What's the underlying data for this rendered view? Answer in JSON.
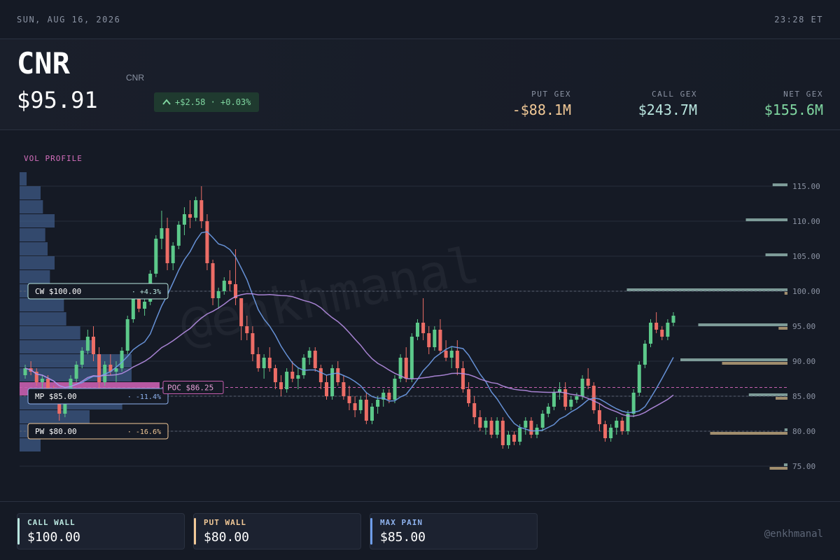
{
  "topbar": {
    "date": "SUN, AUG 16, 2026",
    "time": "23:28 ET"
  },
  "header": {
    "ticker": "CNR",
    "ticker_sub": "CNR",
    "price": "$95.91",
    "change": "+$2.58 · +0.03%"
  },
  "gex": {
    "put": {
      "label": "PUT GEX",
      "value": "-$88.1M"
    },
    "call": {
      "label": "CALL GEX",
      "value": "$243.7M"
    },
    "net": {
      "label": "NET GEX",
      "value": "$155.6M"
    }
  },
  "watermark": "@enkhmanal",
  "chart_data": {
    "type": "candlestick",
    "ylim": [
      73,
      117
    ],
    "y_ticks": [
      "115.00",
      "110.00",
      "105.00",
      "100.00",
      "95.00",
      "90.00",
      "85.00",
      "80.00",
      "75.00"
    ],
    "vol_profile_label": "VOL PROFILE",
    "levels": [
      {
        "label": "CW $100.00",
        "pct": "+4.3%",
        "price": 100,
        "color": "#b9e6df"
      },
      {
        "label": "MP $85.00",
        "pct": "-11.4%",
        "price": 85,
        "color": "#8fb3ef"
      },
      {
        "label": "PW $80.00",
        "pct": "-16.6%",
        "price": 80,
        "color": "#f2c997"
      }
    ],
    "poc": {
      "label": "POC $86.25",
      "price": 86.25
    },
    "gex_bars": {
      "call": [
        [
          115,
          0.25
        ],
        [
          110,
          0.7
        ],
        [
          105,
          0.37
        ],
        [
          100,
          2.7
        ],
        [
          95,
          1.5
        ],
        [
          90,
          1.8
        ],
        [
          85,
          0.65
        ],
        [
          80,
          0.05
        ],
        [
          75,
          0.06
        ]
      ],
      "put": [
        [
          100,
          0.05
        ],
        [
          95,
          0.15
        ],
        [
          90,
          1.1
        ],
        [
          85,
          0.2
        ],
        [
          80,
          1.3
        ],
        [
          75,
          0.3
        ]
      ]
    },
    "volume_profile": [
      [
        116,
        0.15
      ],
      [
        114,
        0.45
      ],
      [
        112,
        0.5
      ],
      [
        110,
        0.75
      ],
      [
        108,
        0.55
      ],
      [
        106,
        0.6
      ],
      [
        104,
        0.75
      ],
      [
        102,
        0.65
      ],
      [
        100,
        0.95
      ],
      [
        98,
        0.95
      ],
      [
        96,
        1.0
      ],
      [
        94,
        1.3
      ],
      [
        92,
        1.6
      ],
      [
        90,
        2.4
      ],
      [
        88,
        2.4
      ],
      [
        86,
        3.0
      ],
      [
        84,
        2.2
      ],
      [
        82,
        1.5
      ],
      [
        80,
        0.7
      ],
      [
        78,
        0.45
      ]
    ],
    "candles": [
      [
        88,
        89.5,
        87.5,
        89
      ],
      [
        89,
        90,
        88,
        88.5
      ],
      [
        88.5,
        89,
        86.5,
        87
      ],
      [
        87,
        88,
        86,
        87.5
      ],
      [
        87.5,
        88,
        85.5,
        86
      ],
      [
        86,
        86.5,
        84,
        85
      ],
      [
        85,
        85.5,
        81.5,
        82.5
      ],
      [
        82.5,
        85,
        82,
        84.5
      ],
      [
        84.5,
        88,
        84,
        87.5
      ],
      [
        87.5,
        90,
        87,
        89.5
      ],
      [
        89.5,
        92,
        89,
        91.5
      ],
      [
        91.5,
        94.5,
        91,
        93.5
      ],
      [
        93.5,
        95,
        90,
        91
      ],
      [
        91,
        92,
        86,
        87
      ],
      [
        87,
        90,
        86.5,
        89.5
      ],
      [
        89.5,
        91,
        88,
        88.5
      ],
      [
        88.5,
        90,
        87,
        89
      ],
      [
        89,
        92,
        88.5,
        91.5
      ],
      [
        91.5,
        96.5,
        91,
        96
      ],
      [
        96,
        99.5,
        95.5,
        99
      ],
      [
        99,
        100,
        97,
        97.5
      ],
      [
        97.5,
        99,
        96.5,
        98.5
      ],
      [
        98.5,
        103,
        98,
        102.5
      ],
      [
        102.5,
        108,
        102,
        107.5
      ],
      [
        107.5,
        111.5,
        106,
        109
      ],
      [
        109,
        110.5,
        103,
        104
      ],
      [
        104,
        107,
        103,
        106.5
      ],
      [
        106.5,
        110,
        106,
        109.5
      ],
      [
        109.5,
        112,
        108,
        111
      ],
      [
        111,
        113,
        109,
        110.5
      ],
      [
        110.5,
        113.5,
        110,
        113
      ],
      [
        113,
        115,
        109,
        110
      ],
      [
        110,
        111,
        103,
        104
      ],
      [
        104,
        104.5,
        98,
        99
      ],
      [
        99,
        100.5,
        97.5,
        100
      ],
      [
        100,
        102,
        99.5,
        101.5
      ],
      [
        101.5,
        103,
        100,
        101
      ],
      [
        101,
        106,
        98,
        99
      ],
      [
        99,
        97,
        93,
        95
      ],
      [
        95,
        96.5,
        93,
        94
      ],
      [
        94,
        95,
        90,
        91
      ],
      [
        91,
        92,
        88.5,
        89
      ],
      [
        89,
        91,
        87.5,
        90.5
      ],
      [
        90.5,
        92,
        88.5,
        89
      ],
      [
        89,
        89.5,
        86,
        87
      ],
      [
        87,
        88,
        85,
        86
      ],
      [
        86,
        89,
        85.5,
        88.5
      ],
      [
        88.5,
        90,
        87,
        87.5
      ],
      [
        87.5,
        89,
        86,
        88
      ],
      [
        88,
        91,
        87.5,
        90.5
      ],
      [
        90.5,
        92,
        89.5,
        91.5
      ],
      [
        91.5,
        92,
        88.5,
        89
      ],
      [
        89,
        89.5,
        86,
        87
      ],
      [
        87,
        88,
        84.5,
        85
      ],
      [
        85,
        89.5,
        84.5,
        89
      ],
      [
        89,
        90,
        86.5,
        87
      ],
      [
        87,
        88,
        84.5,
        85
      ],
      [
        85,
        86.5,
        83,
        84
      ],
      [
        84,
        85,
        82,
        83
      ],
      [
        83,
        85,
        82.5,
        84.5
      ],
      [
        84.5,
        85.5,
        81,
        81.5
      ],
      [
        81.5,
        84,
        81,
        83.5
      ],
      [
        83.5,
        85,
        82.5,
        84.5
      ],
      [
        84.5,
        86,
        83.5,
        85.5
      ],
      [
        85.5,
        86,
        84,
        84.5
      ],
      [
        84.5,
        88,
        84,
        87.5
      ],
      [
        87.5,
        91,
        87,
        90.5
      ],
      [
        90.5,
        92,
        87,
        87.5
      ],
      [
        87.5,
        94,
        87,
        93.5
      ],
      [
        93.5,
        96,
        93,
        95.5
      ],
      [
        95.5,
        99,
        93,
        94
      ],
      [
        94,
        95,
        91,
        92
      ],
      [
        92,
        95,
        91.5,
        94.5
      ],
      [
        94.5,
        96,
        91,
        91.5
      ],
      [
        91.5,
        93,
        90,
        90.5
      ],
      [
        90.5,
        92,
        89,
        91.5
      ],
      [
        91.5,
        93,
        88,
        89
      ],
      [
        89,
        90,
        85.5,
        86
      ],
      [
        86,
        87,
        83.5,
        84
      ],
      [
        84,
        85,
        81,
        82
      ],
      [
        82,
        83,
        80,
        80.5
      ],
      [
        80.5,
        82,
        79.5,
        81.5
      ],
      [
        81.5,
        82,
        79,
        79.5
      ],
      [
        79.5,
        82,
        79,
        81.5
      ],
      [
        81.5,
        82,
        77.5,
        78
      ],
      [
        78,
        80,
        77.5,
        79.5
      ],
      [
        79.5,
        80,
        78,
        78.5
      ],
      [
        78.5,
        81,
        78,
        80.5
      ],
      [
        80.5,
        82,
        79.5,
        81.5
      ],
      [
        81.5,
        82,
        79,
        79.5
      ],
      [
        79.5,
        81,
        79,
        80.5
      ],
      [
        80.5,
        83,
        80,
        82.5
      ],
      [
        82.5,
        84,
        82,
        83.5
      ],
      [
        83.5,
        86,
        83,
        85.5
      ],
      [
        85.5,
        87,
        84.5,
        86
      ],
      [
        86,
        87,
        83,
        83.5
      ],
      [
        83.5,
        85,
        83,
        84.5
      ],
      [
        84.5,
        85.5,
        84,
        85
      ],
      [
        85,
        88,
        84.5,
        87.5
      ],
      [
        87.5,
        89,
        86,
        86.5
      ],
      [
        86.5,
        87,
        82.5,
        83
      ],
      [
        83,
        84,
        80,
        81
      ],
      [
        81,
        81.5,
        78.5,
        79
      ],
      [
        79,
        81,
        78.5,
        80.5
      ],
      [
        80.5,
        82,
        79.5,
        81.5
      ],
      [
        81.5,
        82,
        79.5,
        80
      ],
      [
        80,
        83,
        79.5,
        82.5
      ],
      [
        82.5,
        86,
        82,
        85.5
      ],
      [
        85.5,
        90,
        85,
        89.5
      ],
      [
        89.5,
        93,
        89,
        92.5
      ],
      [
        92.5,
        96,
        92,
        95.5
      ],
      [
        95.5,
        97,
        94,
        94.5
      ],
      [
        94.5,
        95,
        93,
        93.5
      ],
      [
        93.5,
        96,
        93,
        95.5
      ],
      [
        95.5,
        97,
        95,
        96.5
      ]
    ]
  },
  "footer": {
    "call_wall": {
      "label": "CALL WALL",
      "value": "$100.00"
    },
    "put_wall": {
      "label": "PUT WALL",
      "value": "$80.00"
    },
    "max_pain": {
      "label": "MAX PAIN",
      "value": "$85.00"
    },
    "handle": "@enkhmanal"
  }
}
